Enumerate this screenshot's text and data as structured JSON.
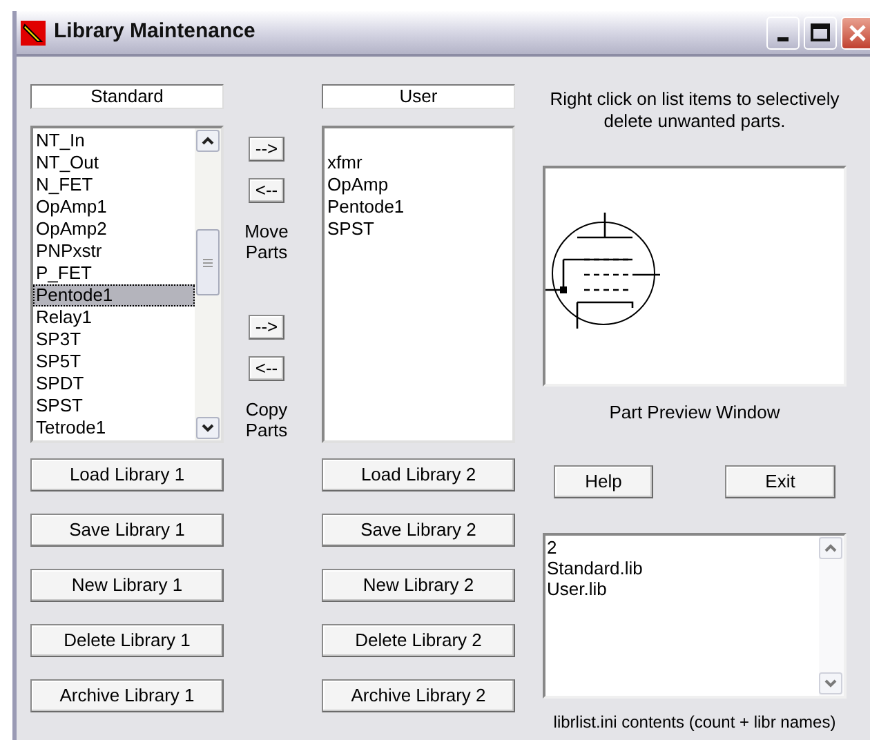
{
  "window": {
    "title": "Library Maintenance"
  },
  "libraries": [
    {
      "name": "Standard",
      "items": [
        {
          "label": "NT_In",
          "selected": false
        },
        {
          "label": "NT_Out",
          "selected": false
        },
        {
          "label": "N_FET",
          "selected": false
        },
        {
          "label": "OpAmp1",
          "selected": false
        },
        {
          "label": "OpAmp2",
          "selected": false
        },
        {
          "label": "PNPxstr",
          "selected": false
        },
        {
          "label": "P_FET",
          "selected": false
        },
        {
          "label": "Pentode1",
          "selected": true
        },
        {
          "label": "Relay1",
          "selected": false
        },
        {
          "label": "SP3T",
          "selected": false
        },
        {
          "label": "SP5T",
          "selected": false
        },
        {
          "label": "SPDT",
          "selected": false
        },
        {
          "label": "SPST",
          "selected": false
        },
        {
          "label": "Tetrode1",
          "selected": false
        }
      ],
      "buttons": [
        "Load Library 1",
        "Save Library 1",
        "New Library 1",
        "Delete Library 1",
        "Archive Library 1"
      ]
    },
    {
      "name": "User",
      "items": [
        {
          "label": "xfmr",
          "selected": false
        },
        {
          "label": "OpAmp",
          "selected": false
        },
        {
          "label": "Pentode1",
          "selected": false
        },
        {
          "label": "SPST",
          "selected": false
        }
      ],
      "buttons": [
        "Load Library 2",
        "Save Library 2",
        "New Library 2",
        "Delete Library 2",
        "Archive Library 2"
      ]
    }
  ],
  "transfer_groups": [
    {
      "buttons": [
        "-->",
        "<--"
      ],
      "caption": "Move Parts"
    },
    {
      "buttons": [
        "-->",
        "<--"
      ],
      "caption": "Copy Parts"
    }
  ],
  "hint": "Right click on list items to selectively delete unwanted parts.",
  "preview": {
    "caption": "Part Preview Window"
  },
  "actions": [
    "Help",
    "Exit"
  ],
  "librlist": {
    "lines": [
      "2",
      "Standard.lib",
      "User.lib"
    ],
    "caption": "librlist.ini contents (count + libr names)"
  }
}
